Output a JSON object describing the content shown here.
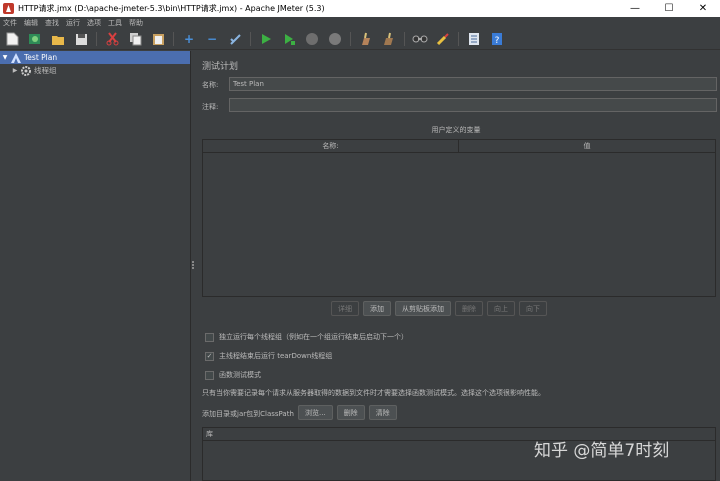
{
  "window": {
    "title": "HTTP请求.jmx (D:\\apache-jmeter-5.3\\bin\\HTTP请求.jmx) - Apache JMeter (5.3)",
    "minimize": "—",
    "maximize": "☐",
    "close": "✕"
  },
  "menu": [
    "文件",
    "编辑",
    "查找",
    "运行",
    "选项",
    "工具",
    "帮助"
  ],
  "toolbar": {
    "icons": [
      "new-icon",
      "templates-icon",
      "open-icon",
      "save-icon",
      "cut-icon",
      "copy-icon",
      "paste-icon",
      "expand-icon",
      "collapse-icon",
      "toggle-icon",
      "start-icon",
      "start-no-pause-icon",
      "stop-icon",
      "shutdown-icon",
      "clear-icon",
      "clear-all-icon",
      "search-icon",
      "reset-search-icon",
      "function-helper-icon",
      "help-icon"
    ]
  },
  "tree": {
    "items": [
      {
        "label": "Test Plan",
        "selected": true,
        "expanded": true
      },
      {
        "label": "线程组",
        "selected": false,
        "expanded": false
      }
    ]
  },
  "main": {
    "panel_title": "测试计划",
    "name_label": "名称:",
    "name_value": "Test Plan",
    "comment_label": "注释:",
    "comment_value": "",
    "vars_caption": "用户定义的变量",
    "table_headers": [
      "名称:",
      "值"
    ],
    "buttons": [
      {
        "label": "详细",
        "enabled": false
      },
      {
        "label": "添加",
        "enabled": true
      },
      {
        "label": "从剪贴板添加",
        "enabled": true
      },
      {
        "label": "删除",
        "enabled": false
      },
      {
        "label": "向上",
        "enabled": false
      },
      {
        "label": "向下",
        "enabled": false
      }
    ],
    "checkboxes": [
      {
        "label": "独立运行每个线程组（例如在一个组运行结束后启动下一个）",
        "checked": false
      },
      {
        "label": "主线程结束后运行 tearDown线程组",
        "checked": true
      },
      {
        "label": "函数测试模式",
        "checked": false
      }
    ],
    "info_text": "只有当你需要记录每个请求从服务器取得的数据到文件时才需要选择函数测试模式。选择这个选项很影响性能。",
    "classpath_label": "添加目录或jar包到ClassPath",
    "classpath_buttons": [
      "浏览...",
      "删除",
      "清除"
    ],
    "lib_header": "库"
  },
  "watermark": "知乎 @简单7时刻",
  "colors": {
    "background": "#3c3f41",
    "selection": "#4b6eaf",
    "text": "#bbbbbb"
  }
}
